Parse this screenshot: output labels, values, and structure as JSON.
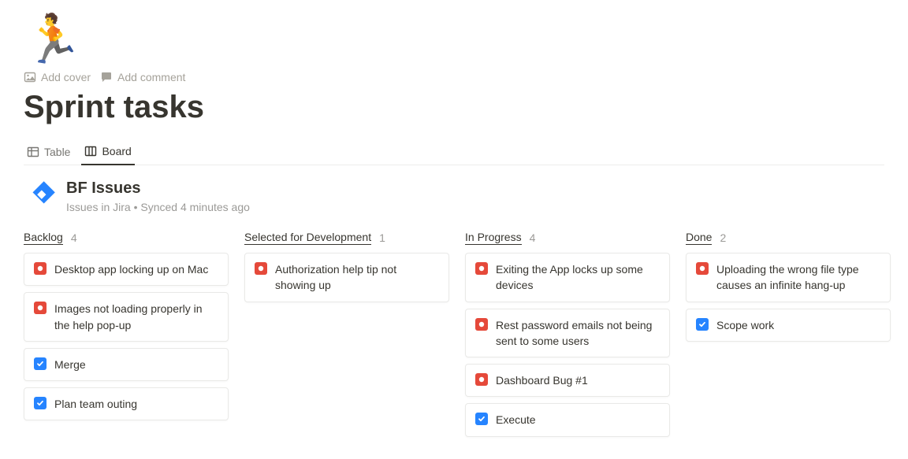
{
  "page": {
    "emoji": "🏃",
    "add_cover_label": "Add cover",
    "add_comment_label": "Add comment",
    "title": "Sprint tasks"
  },
  "tabs": {
    "table": "Table",
    "board": "Board"
  },
  "source": {
    "title": "BF Issues",
    "subtitle": "Issues in Jira  •  Synced 4 minutes ago"
  },
  "columns": [
    {
      "name": "Backlog",
      "count": "4",
      "cards": [
        {
          "icon": "red",
          "text": "Desktop app locking up on Mac"
        },
        {
          "icon": "red",
          "text": "Images not loading properly in the help pop-up"
        },
        {
          "icon": "blue",
          "text": "Merge"
        },
        {
          "icon": "blue",
          "text": "Plan team outing"
        }
      ]
    },
    {
      "name": "Selected for Development",
      "count": "1",
      "cards": [
        {
          "icon": "red",
          "text": "Authorization help tip not showing up"
        }
      ]
    },
    {
      "name": "In Progress",
      "count": "4",
      "cards": [
        {
          "icon": "red",
          "text": "Exiting the App locks up some devices"
        },
        {
          "icon": "red",
          "text": "Rest password emails not being sent to some users"
        },
        {
          "icon": "red",
          "text": "Dashboard Bug #1"
        },
        {
          "icon": "blue",
          "text": "Execute"
        }
      ]
    },
    {
      "name": "Done",
      "count": "2",
      "cards": [
        {
          "icon": "red",
          "text": "Uploading the wrong file type causes an infinite hang-up"
        },
        {
          "icon": "blue",
          "text": "Scope work"
        }
      ]
    }
  ]
}
